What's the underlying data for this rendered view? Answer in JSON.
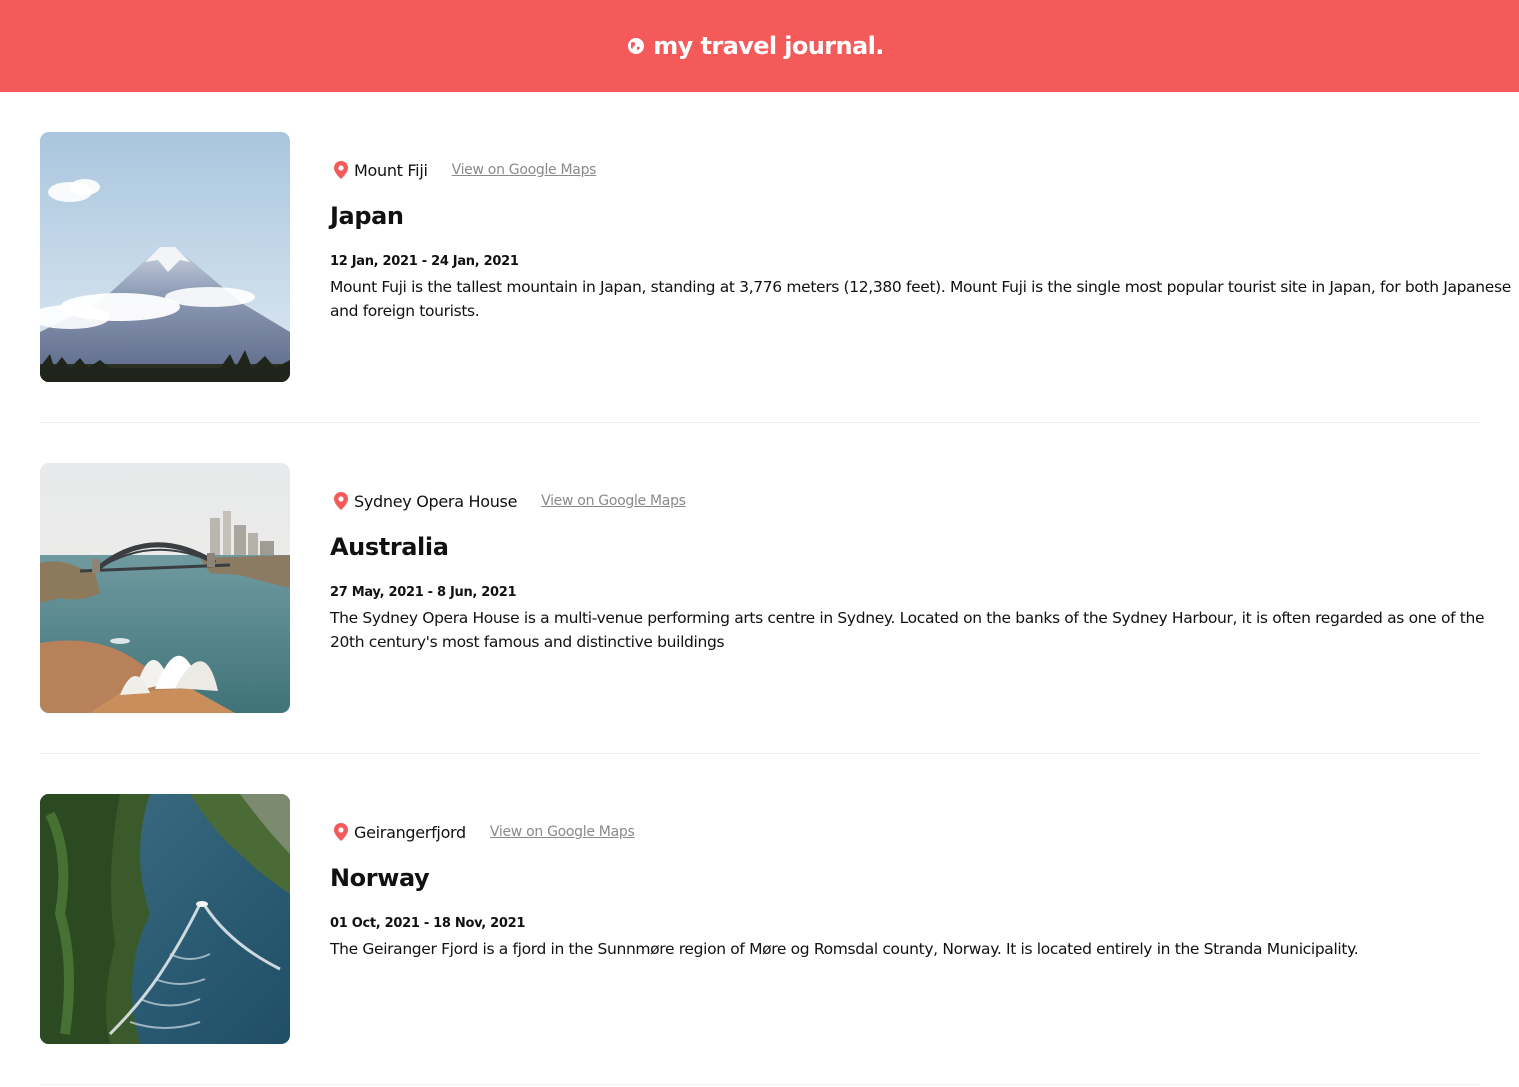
{
  "header": {
    "title": "my travel journal.",
    "accent_color": "#F55A5A",
    "icon": "globe-icon"
  },
  "entries": [
    {
      "location": "Mount Fiji",
      "map_link": "View on Google Maps",
      "country": "Japan",
      "dates": "12 Jan, 2021 - 24 Jan, 2021",
      "description": "Mount Fuji is the tallest mountain in Japan, standing at 3,776 meters (12,380 feet). Mount Fuji is the single most popular tourist site in Japan, for both Japanese and foreign tourists.",
      "image": "mount-fuji-photo"
    },
    {
      "location": "Sydney Opera House",
      "map_link": "View on Google Maps",
      "country": "Australia",
      "dates": "27 May, 2021 - 8 Jun, 2021",
      "description": "The Sydney Opera House is a multi-venue performing arts centre in Sydney. Located on the banks of the Sydney Harbour, it is often regarded as one of the 20th century's most famous and distinctive buildings",
      "image": "sydney-opera-house-photo"
    },
    {
      "location": "Geirangerfjord",
      "map_link": "View on Google Maps",
      "country": "Norway",
      "dates": "01 Oct, 2021 - 18 Nov, 2021",
      "description": "The Geiranger Fjord is a fjord in the Sunnmøre region of Møre og Romsdal county, Norway. It is located entirely in the Stranda Municipality.",
      "image": "geirangerfjord-photo"
    }
  ]
}
